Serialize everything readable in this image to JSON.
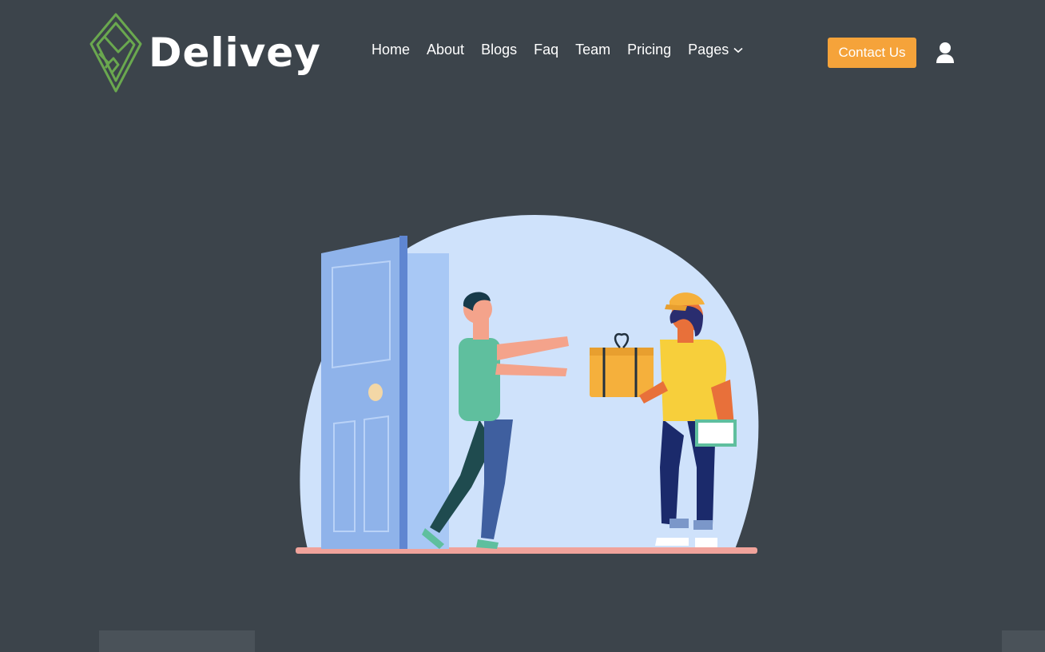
{
  "brand": {
    "name": "Delivey",
    "logo_icon": "hand-box-icon",
    "logo_color": "#6aa84f"
  },
  "nav": {
    "items": [
      {
        "label": "Home"
      },
      {
        "label": "About"
      },
      {
        "label": "Blogs"
      },
      {
        "label": "Faq"
      },
      {
        "label": "Team"
      },
      {
        "label": "Pricing"
      },
      {
        "label": "Pages",
        "icon": "chevron-down-icon"
      }
    ]
  },
  "header": {
    "contact_label": "Contact Us",
    "contact_color": "#f5a33a",
    "user_icon": "user-icon"
  },
  "hero": {
    "illustration": "delivery-person-handing-package-illustration"
  },
  "colors": {
    "background": "#3c444b",
    "accent": "#f5a33a"
  }
}
